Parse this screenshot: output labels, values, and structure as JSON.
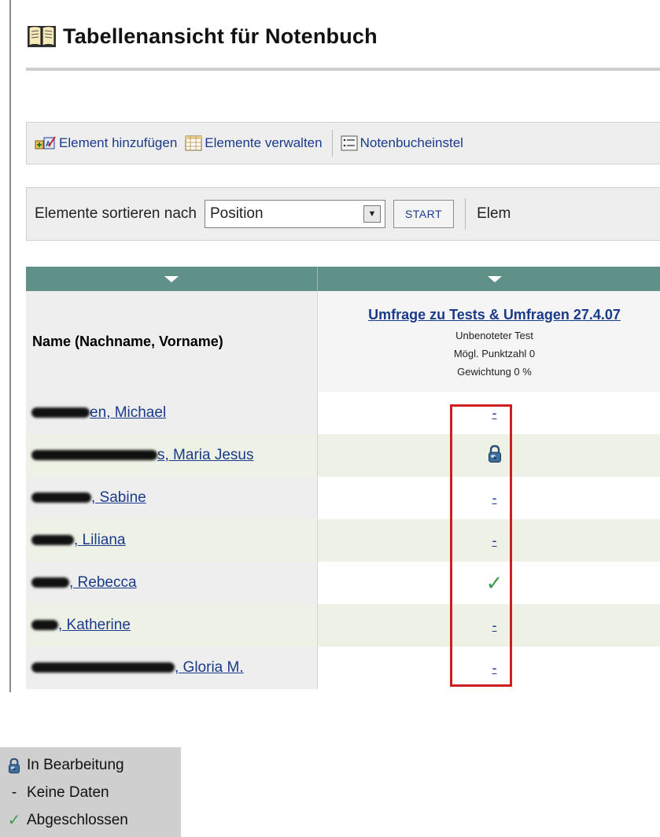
{
  "page": {
    "title": "Tabellenansicht für Notenbuch"
  },
  "toolbar": {
    "add_item": "Element hinzufügen",
    "manage_items": "Elemente verwalten",
    "settings": "Notenbucheinstel"
  },
  "sortbar": {
    "label": "Elemente sortieren nach",
    "selected": "Position",
    "start_button": "START",
    "extra": "Elem"
  },
  "table": {
    "name_header": "Name (Nachname, Vorname)",
    "column": {
      "title": "Umfrage zu Tests & Umfragen 27.4.07",
      "type": "Unbenoteter Test",
      "points": "Mögl. Punktzahl 0",
      "weight": "Gewichtung 0 %"
    },
    "rows": [
      {
        "name_suffix": "en, Michael",
        "status": "none",
        "value": "-"
      },
      {
        "name_suffix": "s, Maria Jesus",
        "status": "in-progress",
        "value": ""
      },
      {
        "name_suffix": ", Sabine",
        "status": "none",
        "value": "-"
      },
      {
        "name_suffix": ", Liliana",
        "status": "none",
        "value": "-"
      },
      {
        "name_suffix": ", Rebecca",
        "status": "completed",
        "value": "✓"
      },
      {
        "name_suffix": ", Katherine",
        "status": "none",
        "value": "-"
      },
      {
        "name_suffix": ", Gloria M.",
        "status": "none",
        "value": "-"
      }
    ]
  },
  "legend": {
    "in_progress": "In Bearbeitung",
    "no_data_symbol": "-",
    "no_data": "Keine Daten",
    "completed": "Abgeschlossen"
  },
  "colors": {
    "link": "#1a3a8a",
    "header_teal": "#5f9189",
    "highlight": "#cc1f1f",
    "check": "#3f9a4f"
  }
}
